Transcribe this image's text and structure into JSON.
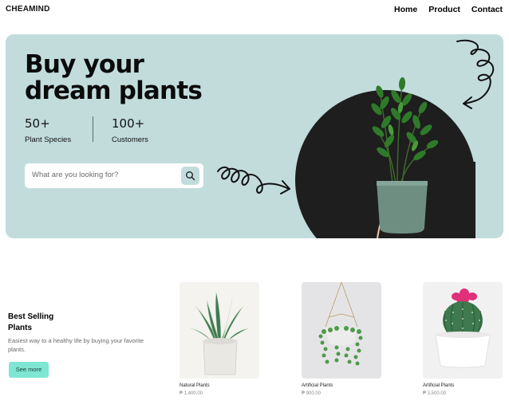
{
  "header": {
    "brand": "CHEAMIND",
    "nav": [
      "Home",
      "Product",
      "Contact"
    ]
  },
  "hero": {
    "title_line1": "Buy your",
    "title_line2": "dream plants",
    "stats": [
      {
        "value": "50+",
        "label": "Plant Species"
      },
      {
        "value": "100+",
        "label": "Customers"
      }
    ],
    "search": {
      "placeholder": "What are you looking for?"
    },
    "icons": [
      "search-icon",
      "squiggle-arrow-icon",
      "curl-arrow-icon"
    ]
  },
  "best_selling": {
    "title_line1": "Best Selling",
    "title_line2": "Plants",
    "description": "Easiest way to a healthy life by buying your favorite plants.",
    "button": "See more"
  },
  "products": [
    {
      "name": "Natural Plants",
      "price": "₱ 1,400.00"
    },
    {
      "name": "Artificial Plants",
      "price": "₱ 900.00"
    },
    {
      "name": "Artificial Plants",
      "price": "₱ 3,500.00"
    }
  ],
  "colors": {
    "hero_bg": "#c2dcdc",
    "circle": "#1e1e1e",
    "accent_button": "#7ee6d3"
  }
}
